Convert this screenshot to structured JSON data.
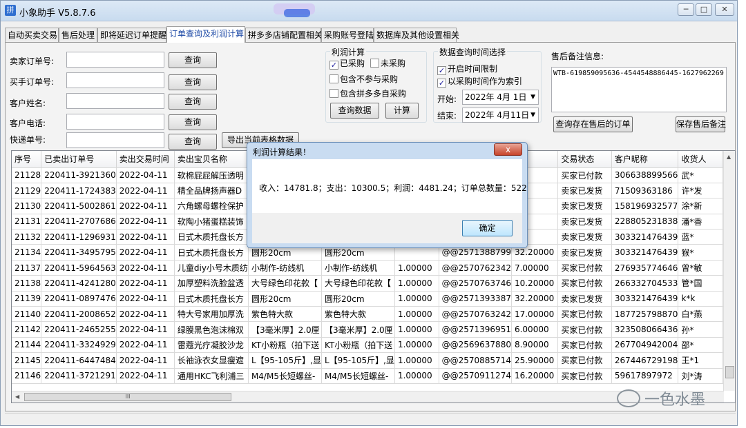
{
  "window": {
    "icon_glyph": "拼",
    "title": "小象助手 V5.8.7.6",
    "minimize": "─",
    "maximize": "□",
    "close": "✕"
  },
  "tabs": [
    {
      "label": "自动买卖交易"
    },
    {
      "label": "售后处理"
    },
    {
      "label": "即将延迟订单提醒"
    },
    {
      "label": "订单查询及利润计算"
    },
    {
      "label": "拼多多店铺配置相关"
    },
    {
      "label": "采购账号登陆"
    },
    {
      "label": "数据库及其他设置相关"
    }
  ],
  "search": {
    "seller_order_label": "卖家订单号:",
    "buyer_order_label": "买手订单号:",
    "customer_name_label": "客户姓名:",
    "customer_phone_label": "客户电话:",
    "tracking_label": "快递单号:",
    "query_label": "查询",
    "export_label": "导出当前表格数据"
  },
  "profit": {
    "group_title": "利润计算",
    "purchased": "已采购",
    "not_purchased": "未采购",
    "include_not_participating": "包含不参与采购",
    "include_pdd_self": "包含拼多多自采购",
    "query_data": "查询数据",
    "calculate": "计算",
    "purchased_checked": true,
    "not_purchased_checked": false,
    "include_not_participating_checked": false,
    "include_pdd_self_checked": false
  },
  "time_filter": {
    "group_title": "数据查询时间选择",
    "enable_limit": "开启时间限制",
    "use_purchase_time": "以采购时间作为索引",
    "start_label": "开始:",
    "end_label": "结束:",
    "start_date": "2022年 4月 1日",
    "end_date": "2022年 4月11日",
    "enable_limit_checked": true,
    "use_purchase_time_checked": true
  },
  "aftersale": {
    "label": "售后备注信息:",
    "note": "WTB-619859095636-4544548886445-1627962269",
    "query_button": "查询存在售后的订单",
    "save_button": "保存售后备注"
  },
  "table": {
    "columns": [
      "序号",
      "已卖出订单号",
      "卖出交易时间",
      "卖出宝贝名称",
      "卖出",
      "",
      "",
      "",
      "",
      "交易状态",
      "客户昵称",
      "收货人",
      "收"
    ],
    "rows": [
      [
        "21128",
        "220411-3921360",
        "2022-04-11",
        "软棉屁屁解压透明",
        "蓝色",
        "",
        "",
        "",
        "",
        "买家已付款",
        "306638899566",
        "武*",
        "1"
      ],
      [
        "21129",
        "220411-1724383",
        "2022-04-11",
        "精全品牌扬声器D",
        "NE7",
        "",
        "",
        "",
        "",
        "卖家已发货",
        "71509363186",
        "许*发",
        "1"
      ],
      [
        "21130",
        "220411-5002861",
        "2022-04-11",
        "六角螺母螺栓保护",
        "M10",
        "",
        "",
        "",
        "",
        "卖家已发货",
        "158196932577",
        "涂*新",
        "1"
      ],
      [
        "21131",
        "220411-2707686",
        "2022-04-11",
        "软陶小猪蛋糕装饰",
        "软陶",
        "",
        "",
        "",
        "",
        "卖家已发货",
        "228805231838",
        "潘*香",
        "1"
      ],
      [
        "21132",
        "220411-1296931",
        "2022-04-11",
        "日式木质托盘长方",
        "圆形",
        "",
        "",
        "",
        "",
        "卖家已发货",
        "303321476439",
        "蓝*",
        "1"
      ],
      [
        "21134",
        "220411-3495795",
        "2022-04-11",
        "日式木质托盘长方",
        "圆形20cm",
        "圆形20cm",
        "",
        "@@2571388799",
        "32.20000",
        "卖家已发货",
        "303321476439",
        "猴*",
        "1"
      ],
      [
        "21137",
        "220411-5964563",
        "2022-04-11",
        "儿童diy小号木质纺",
        "小制作-纺线机",
        "小制作-纺线机",
        "1.00000",
        "@@2570762342",
        "7.00000",
        "买家已付款",
        "276935774646",
        "曾*敏",
        "1"
      ],
      [
        "21138",
        "220411-4241280",
        "2022-04-11",
        "加厚塑料洗脸盆透",
        "大号绿色印花款【",
        "大号绿色印花款【",
        "1.00000",
        "@@2570763746",
        "10.20000",
        "买家已付款",
        "266332704533",
        "管*国",
        "1"
      ],
      [
        "21139",
        "220411-0897476",
        "2022-04-11",
        "日式木质托盘长方",
        "圆形20cm",
        "圆形20cm",
        "1.00000",
        "@@2571393387",
        "32.20000",
        "卖家已发货",
        "303321476439",
        "k*k",
        "1"
      ],
      [
        "21140",
        "220411-2008652",
        "2022-04-11",
        "特大号家用加厚洗",
        "紫色特大款",
        "紫色特大款",
        "1.00000",
        "@@2570763242",
        "17.00000",
        "买家已付款",
        "187725798870",
        "白*燕",
        "1"
      ],
      [
        "21142",
        "220411-2465255",
        "2022-04-11",
        "绿膜黑色泡沫棉双",
        "【3毫米厚】2.0厘",
        "【3毫米厚】2.0厘",
        "1.00000",
        "@@2571396951",
        "6.00000",
        "买家已付款",
        "323508066436",
        "孙*",
        "1"
      ],
      [
        "21144",
        "220411-3324929",
        "2022-04-11",
        "雷蔻光疗凝胶沙龙",
        "KT小粉瓶（拍下送",
        "KT小粉瓶（拍下送",
        "1.00000",
        "@@2569637880",
        "8.90000",
        "买家已付款",
        "267704942004",
        "邵*",
        "1"
      ],
      [
        "21145",
        "220411-6447484",
        "2022-04-11",
        "长袖泳衣女显瘦遮",
        "L【95-105斤】,显",
        "L【95-105斤】,显",
        "1.00000",
        "@@2570885714",
        "25.90000",
        "买家已付款",
        "267446729198",
        "王*1",
        "1"
      ],
      [
        "21146",
        "220411-3721291",
        "2022-04-11",
        "通用HKC飞利浦三",
        "M4/M5长短螺丝-",
        "M4/M5长短螺丝-",
        "1.00000",
        "@@2570911274",
        "16.20000",
        "买家已付款",
        "59617897972",
        "刘*涛",
        "1"
      ]
    ]
  },
  "dialog": {
    "title": "利润计算结果！",
    "close": "x",
    "message": "收入：14781.8；支出：10300.5；利润：4481.24；订单总数量：522",
    "ok": "确定"
  },
  "watermark": "一色水墨"
}
